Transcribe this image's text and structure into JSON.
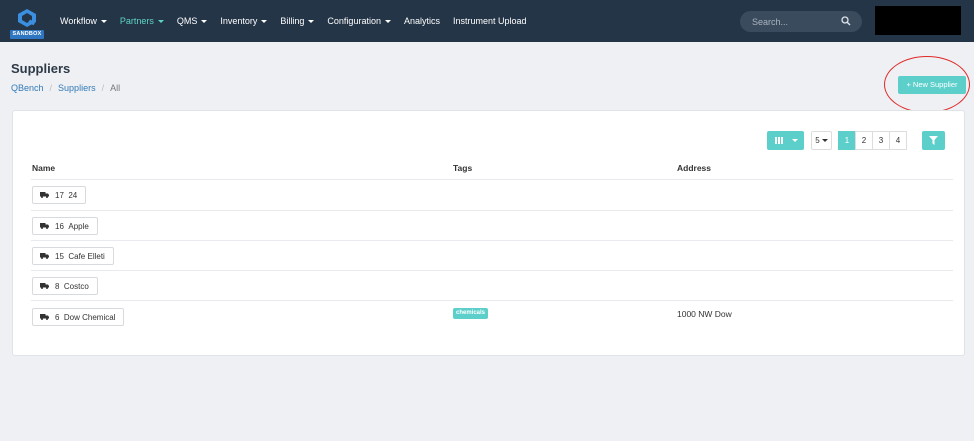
{
  "nav": {
    "logo_badge": "SANDBOX",
    "items": [
      "Workflow",
      "Partners",
      "QMS",
      "Inventory",
      "Billing",
      "Configuration",
      "Analytics",
      "Instrument Upload"
    ],
    "active_item": "Partners",
    "search_placeholder": "Search..."
  },
  "page": {
    "title": "Suppliers",
    "breadcrumb": [
      "QBench",
      "Suppliers",
      "All"
    ],
    "new_button": "+ New Supplier"
  },
  "toolbar": {
    "per_page": "5",
    "pages": [
      "1",
      "2",
      "3",
      "4"
    ],
    "active_page": "1"
  },
  "table": {
    "headers": [
      "Name",
      "Tags",
      "Address"
    ],
    "rows": [
      {
        "id": "17",
        "name": "24",
        "tags": [],
        "address": ""
      },
      {
        "id": "16",
        "name": "Apple",
        "tags": [],
        "address": ""
      },
      {
        "id": "15",
        "name": "Cafe Elleti",
        "tags": [],
        "address": ""
      },
      {
        "id": "8",
        "name": "Costco",
        "tags": [],
        "address": ""
      },
      {
        "id": "6",
        "name": "Dow Chemical",
        "tags": [
          "chemicals"
        ],
        "address": "1000 NW Dow"
      }
    ]
  },
  "colors": {
    "navbar": "#253548",
    "accent": "#5dcfcb",
    "active_nav": "#5dd5c4",
    "annotation": "#e02a2a"
  },
  "icons": [
    "qbench-logo-icon",
    "search-icon",
    "columns-icon",
    "filter-icon",
    "truck-icon"
  ]
}
